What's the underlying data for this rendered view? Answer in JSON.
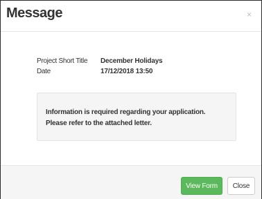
{
  "dialog": {
    "title": "Message",
    "close_glyph": "×",
    "close_icon": "close-icon"
  },
  "details": {
    "project_label": "Project Short Title",
    "project_value": "December Holidays",
    "date_label": "Date",
    "date_value": "17/12/2018 13:50"
  },
  "info": {
    "text": "Information is required regarding your application. Please refer to the attached letter."
  },
  "footer": {
    "view_form_label": "View Form",
    "close_label": "Close"
  },
  "colors": {
    "primary_button": "#5cb85c",
    "footer_background": "#f5f5f5",
    "info_background": "#f5f5f5"
  }
}
